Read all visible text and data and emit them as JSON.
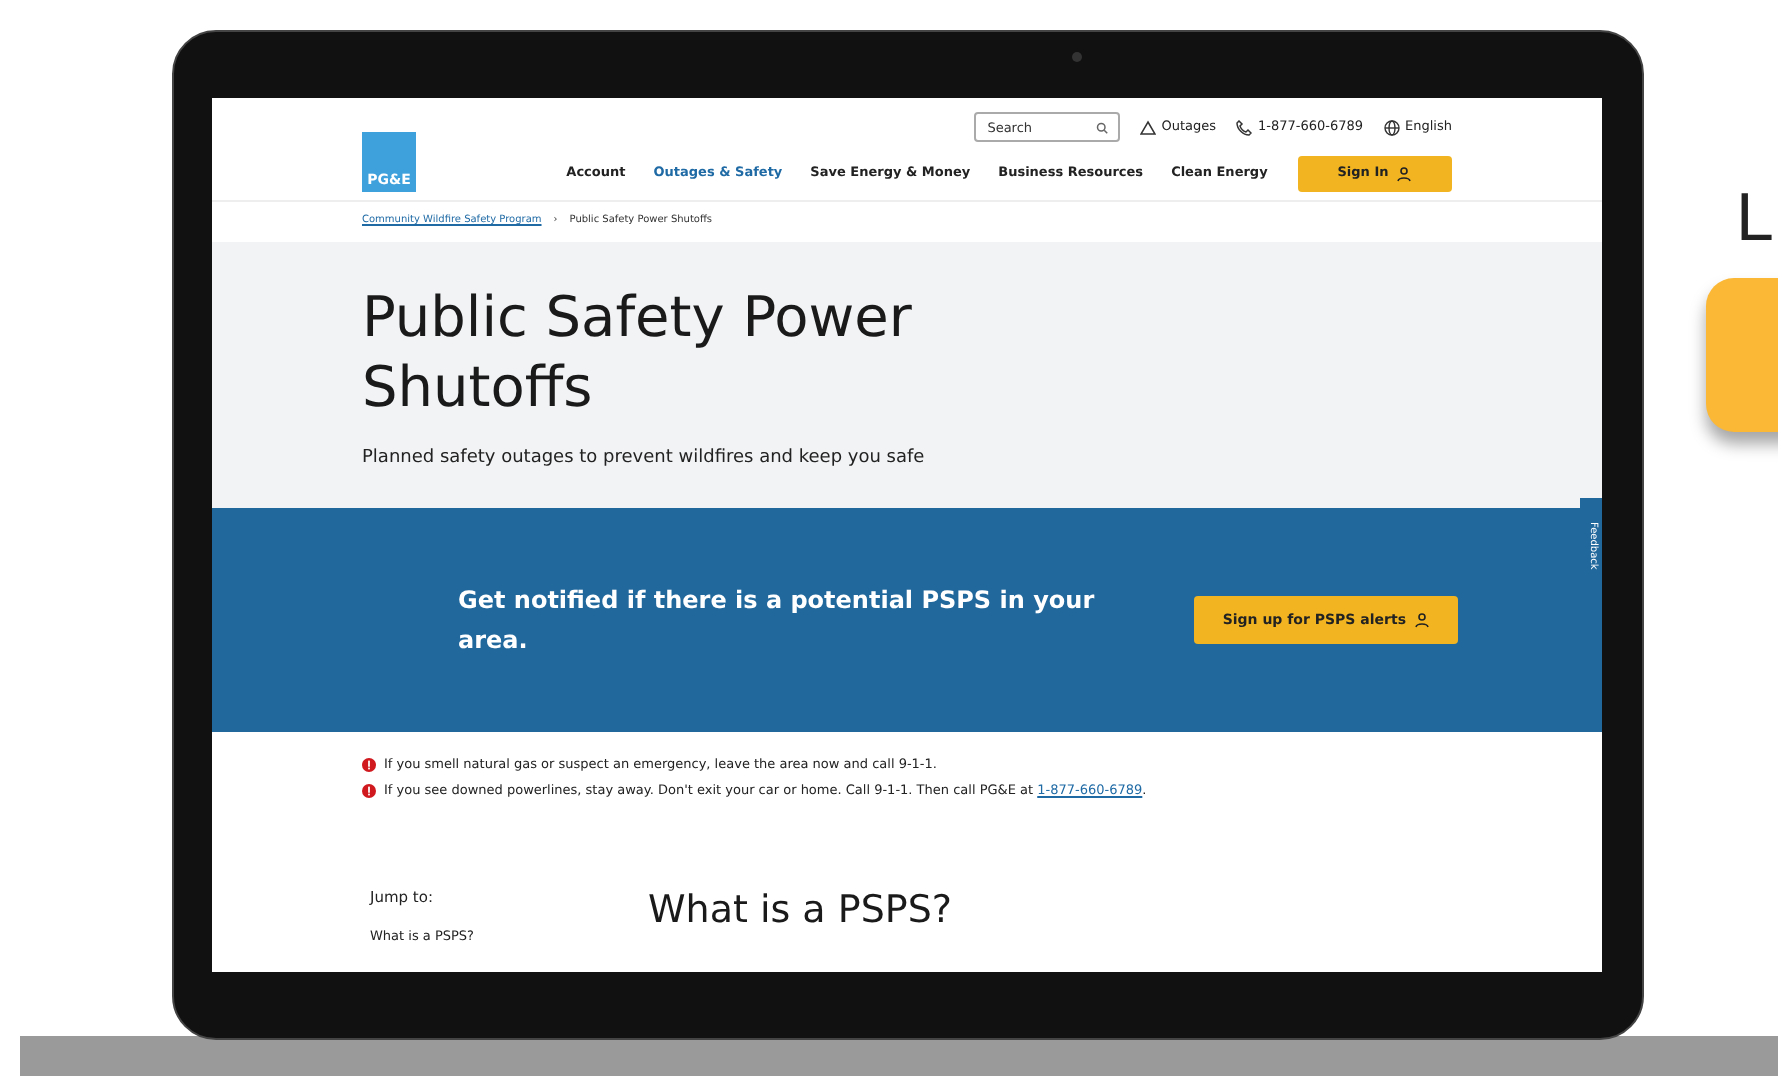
{
  "backdrop": {
    "letter": "L"
  },
  "header": {
    "logo": "PG&E",
    "search": {
      "placeholder": "Search"
    },
    "utility_links": [
      {
        "kind": "outages",
        "label": "Outages"
      },
      {
        "kind": "phone",
        "label": "1-877-660-6789"
      },
      {
        "kind": "language",
        "label": "English"
      }
    ],
    "nav": [
      {
        "label": "Account",
        "selected": false
      },
      {
        "label": "Outages & Safety",
        "selected": true
      },
      {
        "label": "Save Energy & Money",
        "selected": false
      },
      {
        "label": "Business Resources",
        "selected": false
      },
      {
        "label": "Clean Energy",
        "selected": false
      }
    ],
    "sign_in": "Sign In"
  },
  "breadcrumb": [
    {
      "label": "Community Wildfire Safety Program",
      "kind": "link"
    },
    {
      "label": "›",
      "kind": "separator"
    },
    {
      "label": "Public Safety Power Shutoffs",
      "kind": "current"
    }
  ],
  "hero": {
    "title": "Public Safety Power Shutoffs",
    "subtitle": "Planned safety outages to prevent wildfires and keep you safe"
  },
  "banner": {
    "text": "Get notified if there is a potential PSPS in your area.",
    "button": "Sign up for PSPS alerts"
  },
  "feedback_tab": "Feedback",
  "alerts": [
    {
      "text": "If you smell natural gas or suspect an emergency, leave the area now and call 9-1-1."
    },
    {
      "text": "If you see downed powerlines, stay away. Don't exit your car or home. Call 9-1-1. Then call PG&E at",
      "link": "1-877-660-6789",
      "after": "."
    }
  ],
  "jump": {
    "label": "Jump to:",
    "items": [
      "What is a PSPS?"
    ]
  },
  "section_title": "What is a PSPS?"
}
